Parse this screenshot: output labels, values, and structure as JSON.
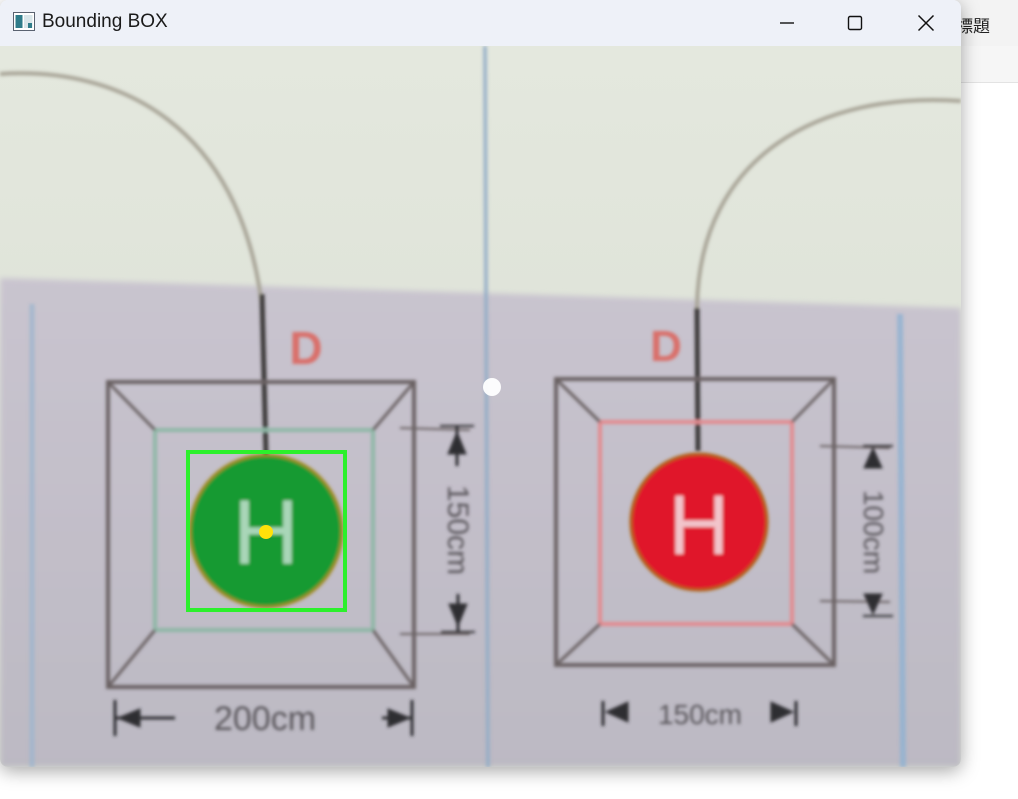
{
  "window": {
    "title": "Bounding BOX",
    "controls": {
      "minimize": "minimize",
      "maximize": "maximize",
      "close": "close"
    }
  },
  "background_window": {
    "title_fragment": "標題"
  },
  "camera_view": {
    "left_pad": {
      "letter": "D",
      "symbol": "H",
      "color": "#179a30",
      "width_dimension": "200cm",
      "height_dimension": "150cm"
    },
    "right_pad": {
      "letter": "D",
      "symbol": "H",
      "color": "#e0132a",
      "width_dimension": "150cm",
      "height_dimension": "100cm"
    },
    "detection_box_color": "#2cf02c",
    "center_point_color": "#ffe10a"
  }
}
